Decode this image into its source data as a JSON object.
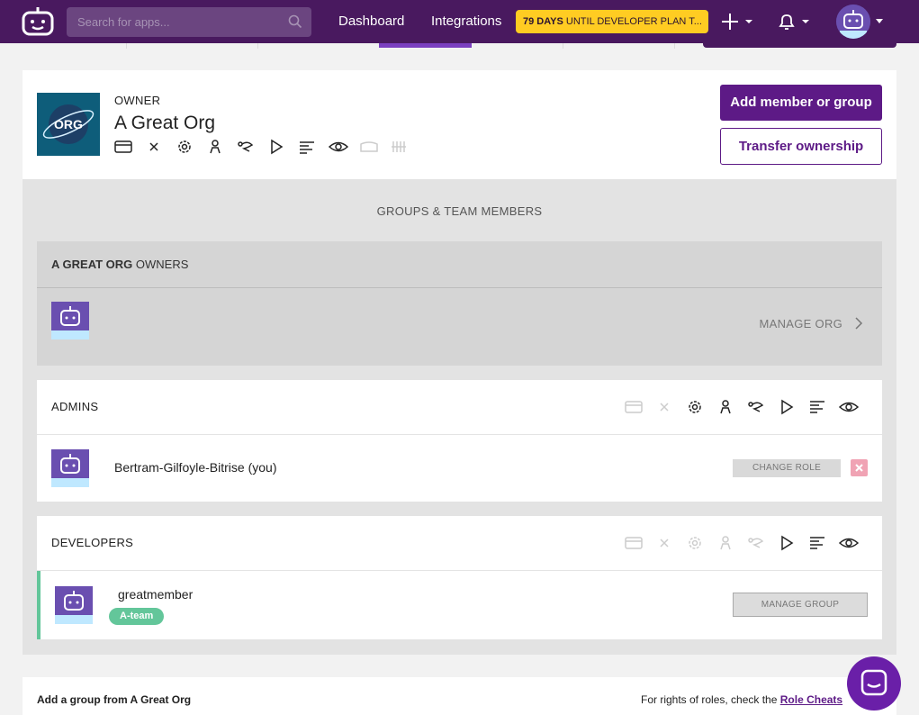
{
  "topbar": {
    "search_placeholder": "Search for apps...",
    "nav": [
      "Dashboard",
      "Integrations"
    ],
    "trial_days": "79 DAYS",
    "trial_rest": " UNTIL DEVELOPER PLAN T..."
  },
  "owner": {
    "label": "OWNER",
    "org_name": "A Great Org",
    "org_logo_text": "ORG",
    "add_button": "Add member or group",
    "transfer_button": "Transfer ownership"
  },
  "groups": {
    "title": "GROUPS & TEAM MEMBERS",
    "owners_header_bold": "A GREAT ORG",
    "owners_header_rest": " OWNERS",
    "manage_org": "MANAGE ORG",
    "admins": {
      "header": "ADMINS",
      "member_name": "Bertram-Gilfoyle-Bitrise (you)",
      "change_role": "CHANGE ROLE"
    },
    "developers": {
      "header": "DEVELOPERS",
      "member_name": "greatmember",
      "tag": "A-team",
      "manage_group": "MANAGE GROUP"
    }
  },
  "bottom": {
    "add_group_label": "Add a group from A Great Org",
    "rights_text": "For rights of roles, check the ",
    "rights_link": "Role Cheats"
  },
  "colors": {
    "topbar": "#49195f",
    "accent": "#5d1a86",
    "trial": "#ffcc22",
    "tag": "#63c69a",
    "remove": "#f0a3b4"
  }
}
